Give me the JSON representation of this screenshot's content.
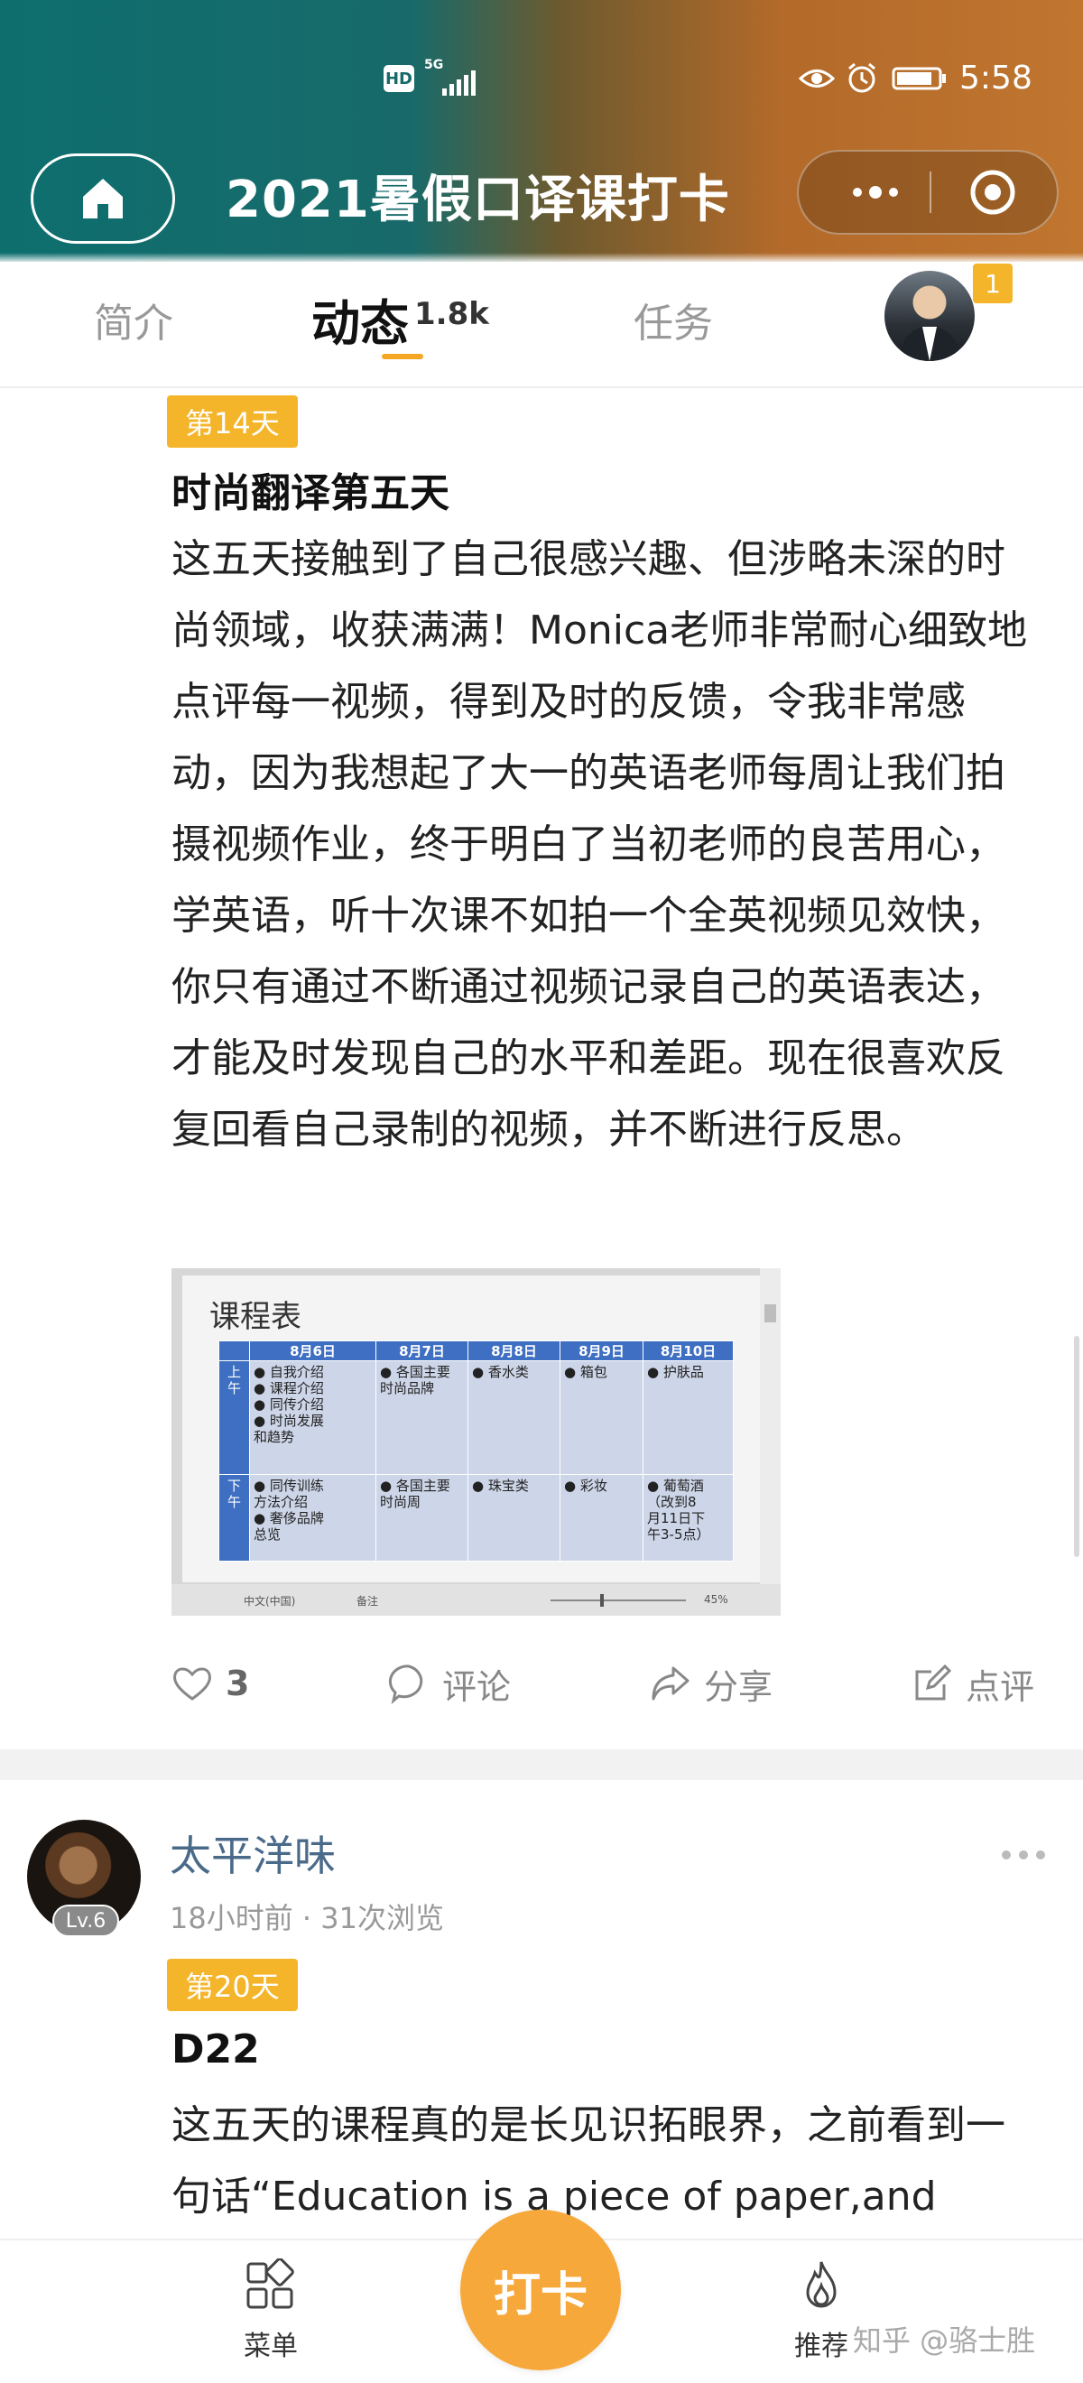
{
  "status_bar": {
    "network": "HD",
    "signal_label": "5G",
    "time": "5:58"
  },
  "header": {
    "title": "2021暑假口译课打卡"
  },
  "tabs": {
    "intro": "简介",
    "feed": "动态",
    "feed_count": "1.8k",
    "task": "任务",
    "notification_count": "1"
  },
  "post1": {
    "day_tag": "第14天",
    "title": "时尚翻译第五天",
    "body": "这五天接触到了自己很感兴趣、但涉略未深的时尚领域，收获满满！Monica老师非常耐心细致地点评每一视频，得到及时的反馈，令我非常感动，因为我想起了大一的英语老师每周让我们拍摄视频作业，终于明白了当初老师的良苦用心，学英语，听十次课不如拍一个全英视频见效快，你只有通过不断通过视频记录自己的英语表达，才能及时发现自己的水平和差距。现在很喜欢反复回看自己录制的视频，并不断进行反思。",
    "image": {
      "title": "课程表",
      "headers": [
        "8月6日",
        "8月7日",
        "8月8日",
        "8月9日",
        "8月10日"
      ],
      "row_labels": [
        "上午",
        "下午"
      ],
      "morning": [
        [
          "● 自我介绍",
          "● 课程介绍",
          "● 同传介绍",
          "● 时尚发展",
          "  和趋势"
        ],
        [
          "● 各国主要",
          "  时尚品牌"
        ],
        [
          "● 香水类"
        ],
        [
          "● 箱包"
        ],
        [
          "● 护肤品"
        ]
      ],
      "afternoon": [
        [
          "● 同传训练",
          "  方法介绍",
          "● 奢侈品牌",
          "  总览"
        ],
        [
          "● 各国主要",
          "  时尚周"
        ],
        [
          "● 珠宝类"
        ],
        [
          "● 彩妆"
        ],
        [
          "● 葡萄酒",
          "（改到8",
          "月11日下",
          "午3-5点）"
        ]
      ],
      "footer_lang": "中文(中国)",
      "footer_notes": "备注",
      "footer_zoom": "45%"
    },
    "likes": "3",
    "comment_label": "评论",
    "share_label": "分享",
    "review_label": "点评"
  },
  "post2": {
    "author": "太平洋味",
    "level": "Lv.6",
    "meta": "18小时前 · 31次浏览",
    "day_tag": "第20天",
    "title": "D22",
    "body": "这五天的课程真的是长见识拓眼界，之前看到一句话“Education is a piece of paper,and"
  },
  "bottom_nav": {
    "menu_label": "菜单",
    "checkin_label": "打卡",
    "recommend_label": "推荐",
    "watermark": "知乎 @骆士胜"
  },
  "colors": {
    "accent": "#f5b52a",
    "checkin": "#f7a83a",
    "author_name": "#4a6a8a"
  }
}
